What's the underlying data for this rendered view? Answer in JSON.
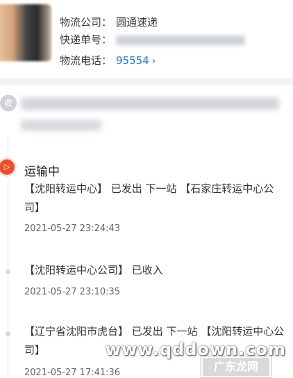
{
  "header": {
    "company_label": "物流公司：",
    "company_value": "圆通速递",
    "tracking_label": "快递单号：",
    "phone_label": "物流电话：",
    "phone_value": "95554",
    "phone_chevron": "›"
  },
  "receiver": {
    "badge": "收"
  },
  "timeline": {
    "status": "运输中",
    "events": [
      {
        "text": "【沈阳转运中心】 已发出 下一站 【石家庄转运中心公司】",
        "time": "2021-05-27 23:24:43"
      },
      {
        "text": "【沈阳转运中心公司】 已收入",
        "time": "2021-05-27 23:10:35"
      },
      {
        "text": "【辽宁省沈阳市虎台】 已发出 下一站 【沈阳转运中心公司】",
        "time": "2021-05-27 17:41:36"
      }
    ]
  },
  "watermark": {
    "url": "www.qddown.com",
    "brand": "广东龙网"
  },
  "icons": {
    "truck": "truck-icon",
    "chevron": "chevron-right-icon"
  }
}
